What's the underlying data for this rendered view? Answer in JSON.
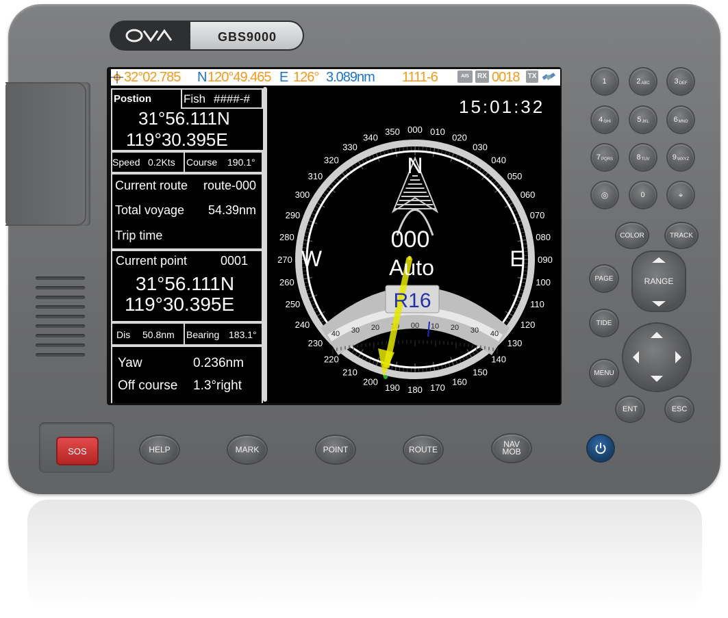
{
  "device": {
    "brand_logo": "OVA",
    "model": "GBS9000"
  },
  "statusbar": {
    "lat": "32°02.785",
    "lat_hemi": "N",
    "lon": "120°49.465",
    "lon_hemi": "E",
    "heading": "126°",
    "distance": "3.089nm",
    "waypoint": "1111-6",
    "ais_label": "AIS",
    "rx_label": "RX",
    "count": "0018",
    "tx_label": "TX",
    "colors": {
      "orange": "#f39a1e",
      "blue": "#1c73c8"
    }
  },
  "left": {
    "position_label": "Postion",
    "fish_label": "Fish",
    "fish_value": "####-#",
    "lat": "31°56.111N",
    "lon": "119°30.395E",
    "speed_label": "Speed",
    "speed_value": "0.2Kts",
    "course_label": "Course",
    "course_value": "190.1°",
    "current_route_label": "Current route",
    "current_route_value": "route-000",
    "total_voyage_label": "Total voyage",
    "total_voyage_value": "54.39nm",
    "trip_time_label": "Trip time",
    "current_point_label": "Current point",
    "current_point_value": "0001",
    "cp_lat": "31°56.111N",
    "cp_lon": "119°30.395E",
    "dis_label": "Dis",
    "dis_value": "50.8nm",
    "bearing_label": "Bearing",
    "bearing_value": "183.1°",
    "yaw_label": "Yaw",
    "yaw_value": "0.236nm",
    "off_course_label": "Off course",
    "off_course_value": "1.3°right"
  },
  "compass": {
    "time": "15:01:32",
    "north": "N",
    "south": "",
    "east": "E",
    "west": "W",
    "heading": "000",
    "mode": "Auto",
    "rudder": "R16",
    "deg_labels": [
      "000",
      "010",
      "020",
      "030",
      "040",
      "050",
      "060",
      "070",
      "080",
      "090",
      "100",
      "110",
      "120",
      "130",
      "140",
      "150",
      "160",
      "170",
      "180",
      "190",
      "200",
      "210",
      "220",
      "230",
      "240",
      "250",
      "260",
      "270",
      "280",
      "290",
      "300",
      "310",
      "320",
      "330",
      "340",
      "350"
    ],
    "scale_labels": [
      "40",
      "30",
      "20",
      "10",
      "00",
      "10",
      "20",
      "30",
      "40"
    ],
    "pointer_color": "#e6e600"
  },
  "keypad": {
    "keys": [
      "1",
      "2",
      "3",
      "4",
      "5",
      "6",
      "7",
      "8",
      "9",
      "",
      "0",
      ""
    ],
    "subs": [
      "",
      "ABC",
      "DEF",
      "GHI",
      "JKL",
      "MNO",
      "PQRS",
      "TUV",
      "WXYZ",
      "",
      "",
      ""
    ],
    "color": "COLOR",
    "track": "TRACK",
    "page": "PAGE",
    "range": "RANGE",
    "tide": "TIDE",
    "menu": "MENU",
    "ent": "ENT",
    "esc": "ESC"
  },
  "bottom": {
    "sos": "SOS",
    "help": "HELP",
    "mark": "MARK",
    "point": "POINT",
    "route": "ROUTE",
    "nav": "NAV",
    "mob": "MOB"
  }
}
